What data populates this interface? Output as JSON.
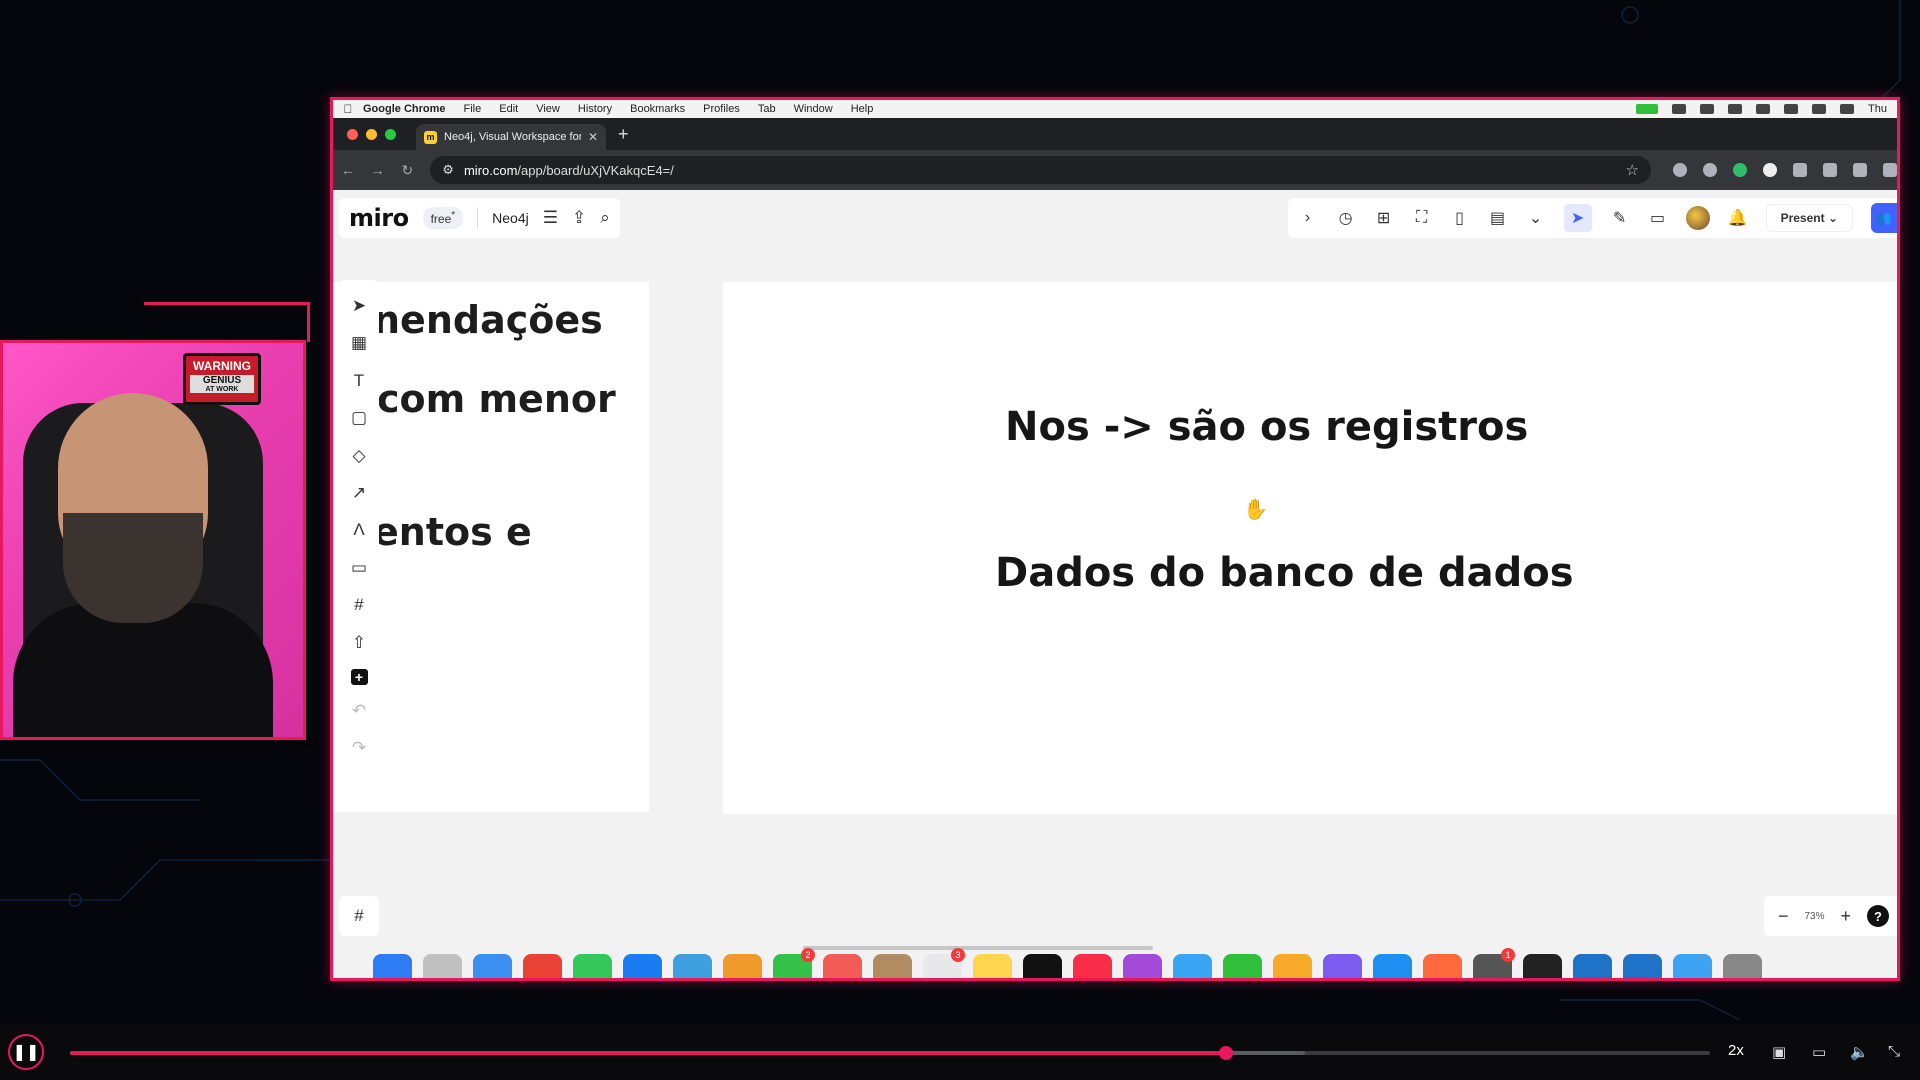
{
  "menubar": {
    "app": "Google Chrome",
    "items": [
      "File",
      "Edit",
      "View",
      "History",
      "Bookmarks",
      "Profiles",
      "Tab",
      "Window",
      "Help"
    ],
    "clock": "Thu"
  },
  "browser": {
    "tab_title": "Neo4j, Visual Workspace for I",
    "url_host": "miro.com",
    "url_path": "/app/board/uXjVKakqcE4=/"
  },
  "miro": {
    "logo": "miro",
    "plan_badge": "free",
    "plan_badge_sup": "*",
    "board_name": "Neo4j",
    "present_label": "Present",
    "zoom_level": "73%"
  },
  "canvas": {
    "left_frame_lines": [
      "nendações",
      "com menor",
      "entos e"
    ],
    "main_line_1": "Nos  ->  são os registros",
    "main_line_2": "Dados do banco de dados"
  },
  "webcam": {
    "sign_line1": "WARNING",
    "sign_line2": "GENIUS",
    "sign_line3": "AT WORK"
  },
  "dock": {
    "colors": [
      "#2e7bf6",
      "#c0c0c0",
      "#3a8ff0",
      "#e94235",
      "#34c759",
      "#1a7cf2",
      "#3fa0e0",
      "#f09a2a",
      "#33c14a",
      "#f25c54",
      "#b08c60",
      "#e8e8ea",
      "#ffd54f",
      "#111111",
      "#fa2d48",
      "#a34ad9",
      "#3ba5f5",
      "#2fbf3a",
      "#f7a928",
      "#7a5cf0",
      "#1d8ff2",
      "#ff6a3d",
      "#555555",
      "#222222",
      "#1e72c8",
      "#1e72c8",
      "#3fa3f3",
      "#888888"
    ],
    "badges": [
      {
        "index": 8,
        "value": "2"
      },
      {
        "index": 11,
        "value": "3"
      },
      {
        "index": 22,
        "value": "1"
      }
    ]
  },
  "player": {
    "speed": "2x",
    "progress": 0.705,
    "buffered": 0.753
  },
  "colors": {
    "accent": "#e8185c",
    "miro_blue": "#4262ff"
  }
}
